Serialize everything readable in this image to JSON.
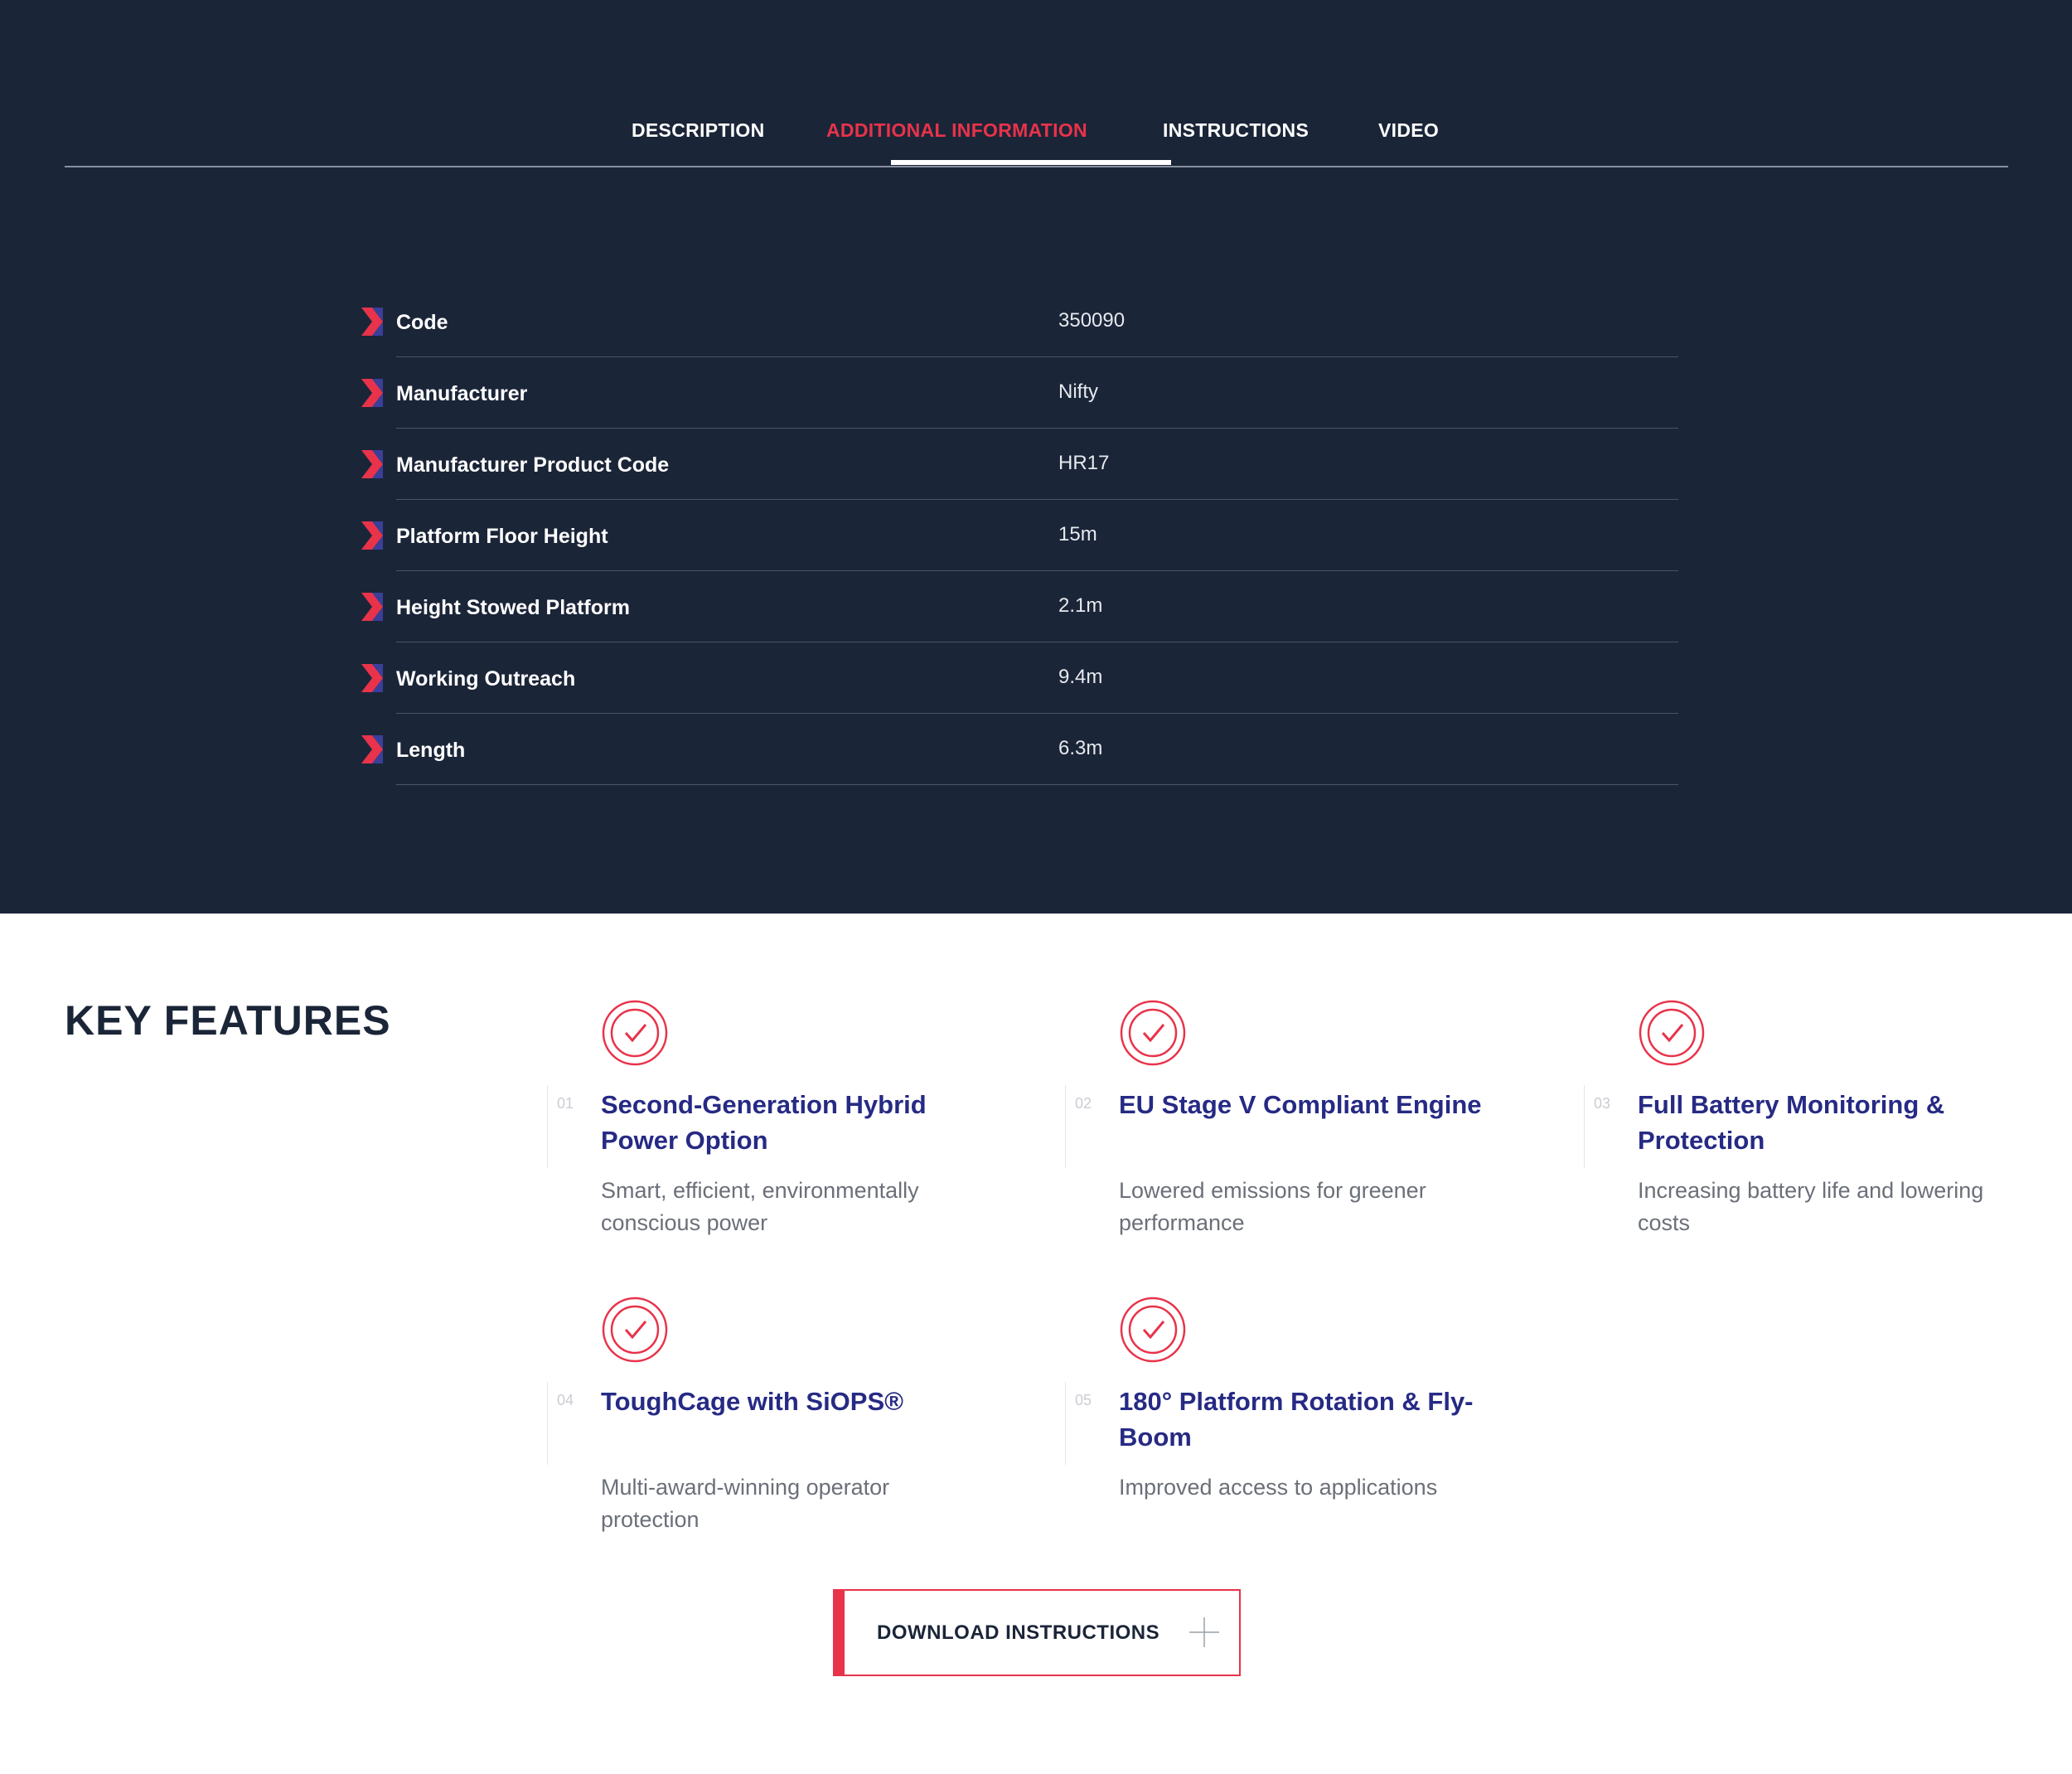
{
  "tabs": [
    {
      "label": "DESCRIPTION",
      "active": false
    },
    {
      "label": "ADDITIONAL INFORMATION",
      "active": true
    },
    {
      "label": "INSTRUCTIONS",
      "active": false
    },
    {
      "label": "VIDEO",
      "active": false
    }
  ],
  "specs": [
    {
      "label": "Code",
      "value": "350090"
    },
    {
      "label": "Manufacturer",
      "value": "Nifty"
    },
    {
      "label": "Manufacturer Product Code",
      "value": "HR17"
    },
    {
      "label": "Platform Floor Height",
      "value": "15m"
    },
    {
      "label": "Height Stowed Platform",
      "value": "2.1m"
    },
    {
      "label": "Working Outreach",
      "value": "9.4m"
    },
    {
      "label": "Length",
      "value": "6.3m"
    }
  ],
  "key_features": {
    "title": "KEY FEATURES",
    "items": [
      {
        "number": "01",
        "title": "Second-Generation Hybrid Power Option",
        "description": "Smart, efficient, environmentally conscious power"
      },
      {
        "number": "02",
        "title": "EU Stage V Compliant Engine",
        "description": "Lowered emissions for greener performance"
      },
      {
        "number": "03",
        "title": "Full Battery Monitoring & Protection",
        "description": "Increasing battery life and lowering costs"
      },
      {
        "number": "04",
        "title": "ToughCage with SiOPS®",
        "description": "Multi-award-winning operator protection"
      },
      {
        "number": "05",
        "title": "180° Platform Rotation & Fly-Boom",
        "description": "Improved access to applications"
      }
    ]
  },
  "download_button": {
    "label": "DOWNLOAD INSTRUCTIONS",
    "icon": "plus-icon"
  },
  "colors": {
    "navy": "#1b2538",
    "accent_red": "#e8334a",
    "feature_blue": "#262a84"
  }
}
